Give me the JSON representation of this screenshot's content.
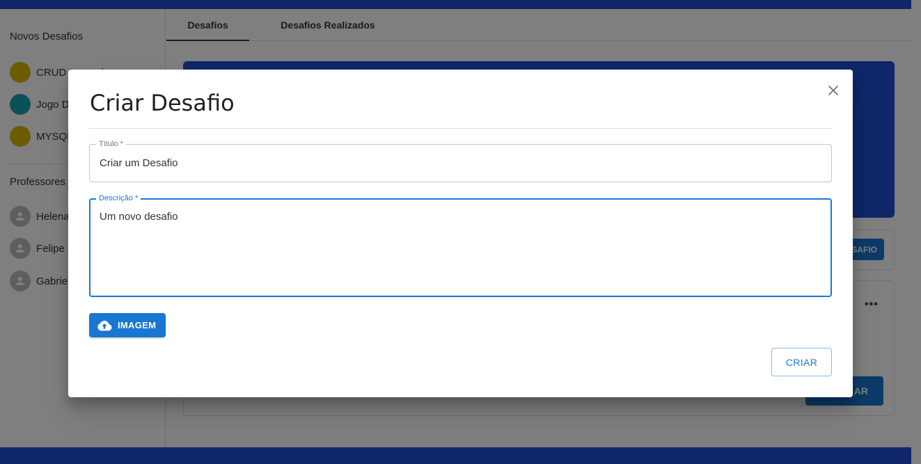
{
  "sidebar": {
    "new_challenges_title": "Novos Desafios",
    "challenges": [
      {
        "label": "CRUD Laravel",
        "color": "#d4b800"
      },
      {
        "label": "Jogo Da Velha",
        "color": "#16a3b5"
      },
      {
        "label": "MYSQL",
        "color": "#d4b800"
      }
    ],
    "teachers_title": "Professores",
    "teachers": [
      {
        "label": "Helena"
      },
      {
        "label": "Felipe"
      },
      {
        "label": "Gabriel"
      }
    ]
  },
  "tabs": [
    {
      "label": "Desafios",
      "active": true
    },
    {
      "label": "Desafios Realizados",
      "active": false
    }
  ],
  "main": {
    "card1_button_label": "SAFIO",
    "card2_more_icon": "more-horiz-icon",
    "card2_button_label": "AR"
  },
  "modal": {
    "title": "Criar Desafio",
    "close_icon": "close-icon",
    "title_field": {
      "label": "Título *",
      "value": "Criar um Desafio"
    },
    "description_field": {
      "label": "Descrição *",
      "value": "Um novo desafio"
    },
    "image_button": {
      "label": "IMAGEM",
      "icon": "cloud-upload-icon"
    },
    "create_button": {
      "label": "CRIAR"
    }
  },
  "colors": {
    "primary": "#1976d2",
    "brand_bar": "#1e4fd0",
    "overlay": "rgba(0,0,0,0.5)"
  }
}
